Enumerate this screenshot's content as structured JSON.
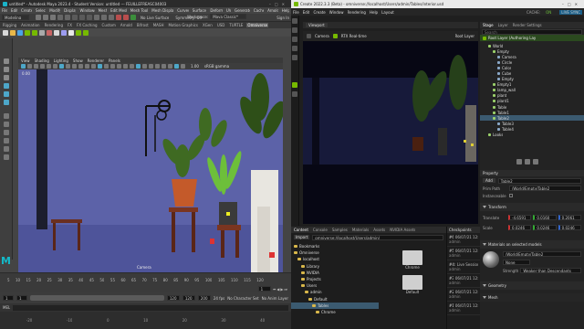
{
  "maya": {
    "title": "untitled* - Autodesk Maya 2023.4 - Student Version: untitled --- FEUILLEFREASC04003",
    "menu": [
      "File",
      "Edit",
      "Create",
      "Select",
      "Modify",
      "Display",
      "Windows",
      "Mesh",
      "Edit Mesh",
      "Mesh Tools",
      "Mesh Display",
      "Curves",
      "Surfaces",
      "Deform",
      "UV",
      "Generate",
      "Cache",
      "Arnold",
      "Help"
    ],
    "workspace_label": "Workspace:",
    "workspace_value": "Maya Classic*",
    "mode": "Modeling",
    "live_surface": "No Live Surface",
    "symmetry": "Symmetry: Off",
    "sign_in": "Sign In",
    "shelf_tabs": [
      "Rigging",
      "Animation",
      "Rendering",
      "FX",
      "FX Caching",
      "Custom",
      "Arnold",
      "Bifrost",
      "MASH",
      "Motion Graphics",
      "XGen",
      "USD",
      "TURTLE",
      "Omniverse"
    ],
    "active_shelf_tab": "Omniverse",
    "viewport_menu": [
      "View",
      "Shading",
      "Lighting",
      "Show",
      "Renderer",
      "Panels"
    ],
    "viewport_zero": "0.00",
    "viewport_one": "1.00",
    "colorspace": "sRGB gamma",
    "camera_label": "Camera",
    "time_ticks": [
      "5",
      "10",
      "15",
      "20",
      "25",
      "30",
      "35",
      "40",
      "45",
      "50",
      "55",
      "60",
      "65",
      "70",
      "75",
      "80",
      "85",
      "90",
      "95",
      "100",
      "105",
      "110",
      "115",
      "120"
    ],
    "current_frame": "1",
    "range_start": "1",
    "range_start2": "1",
    "range_end": "120",
    "range_end2": "120",
    "range_max": "200",
    "fps": "24 fps",
    "character_set": "No Character Set",
    "anim_layer": "No Anim Layer",
    "cmd_label": "MEL",
    "help_ticks": [
      "-20",
      "-10",
      "0",
      "10",
      "20",
      "30",
      "40"
    ]
  },
  "create": {
    "title": "Create 2022.3.3 (Beta) - omniverse://localhost/Users/admin/Tables/interior.usd",
    "menu": [
      "File",
      "Edit",
      "Create",
      "Window",
      "Rendering",
      "Help",
      "Layout"
    ],
    "cache_label": "CACHE:",
    "cache_state": "ON",
    "live_sync": "LIVE SYNC",
    "viewport_tab": "Viewport",
    "camera_btn": "Camera",
    "rtx_btn": "RTX Real-time",
    "root_layer_btn": "Root Layer",
    "stage_tabs": [
      "Stage",
      "Layer",
      "Render Settings"
    ],
    "stage_search": "Search",
    "root_layer": "Root Layer (Authoring Lay",
    "tree": [
      {
        "label": "World",
        "depth": 1
      },
      {
        "label": "Empty",
        "depth": 2
      },
      {
        "label": "Camera",
        "depth": 3
      },
      {
        "label": "Circle",
        "depth": 3
      },
      {
        "label": "Color",
        "depth": 3
      },
      {
        "label": "Cube",
        "depth": 3
      },
      {
        "label": "Empty",
        "depth": 3
      },
      {
        "label": "Empty1",
        "depth": 2
      },
      {
        "label": "lamp_wall",
        "depth": 2
      },
      {
        "label": "plant",
        "depth": 2
      },
      {
        "label": "plant1",
        "depth": 2
      },
      {
        "label": "Table",
        "depth": 2
      },
      {
        "label": "Table1",
        "depth": 2
      },
      {
        "label": "Table2",
        "depth": 2
      },
      {
        "label": "Table3",
        "depth": 3
      },
      {
        "label": "Table4",
        "depth": 3
      },
      {
        "label": "Looks",
        "depth": 1
      }
    ],
    "selected_index": 13,
    "property_tab": "Property",
    "add_btn": "Add",
    "prim_name": "Table2",
    "prim_path_label": "Prim Path",
    "prim_path": "/World/Empty/Table2",
    "instanceable_label": "Instanceable",
    "transform_label": "Transform",
    "translate_label": "Translate",
    "translate": [
      "-4.6591",
      "0.0160",
      "0.2061"
    ],
    "scale_label": "Scale",
    "scale": [
      "0.0246",
      "0.0246",
      "0.0246"
    ],
    "materials_label": "Materials on selected models",
    "material_path": "/World/Empty/Table2",
    "material_binding": "None",
    "strength_label": "Strength",
    "strength_value": "Weaker than Descendants",
    "geometry_label": "Geometry",
    "mesh_label": "Mesh",
    "content_tabs": [
      "Content",
      "Console",
      "Samples",
      "Materials",
      "Assets",
      "NVIDIA Assets"
    ],
    "import_btn": "Import",
    "content_path": "omniverse://localhost/Users/admin/",
    "folders": [
      "Bookmarks",
      "Omniverse",
      "localhost",
      "Library",
      "NVIDIA",
      "Projects",
      "Users",
      "admin",
      "Default",
      "Tables",
      "Chrome"
    ],
    "thumb_labels": [
      "Chrome",
      "Default"
    ],
    "checkpoints_title": "Checkpoints",
    "checkpoints": [
      {
        "id": "#6:",
        "date": "06/07/21 12:58 PM",
        "user": "admin"
      },
      {
        "id": "#5:",
        "date": "06/07/21 12:58 PM",
        "user": "admin"
      },
      {
        "id": "#4:",
        "date": "Live Session",
        "user": "admin"
      },
      {
        "id": "#3:",
        "date": "06/07/21 12:58 PM",
        "user": "admin"
      },
      {
        "id": "#2:",
        "date": "06/07/21 12:58 PM",
        "user": "admin"
      },
      {
        "id": "#1:",
        "date": "06/07/21 12:58 PM",
        "user": "admin"
      }
    ]
  },
  "colors": {
    "maya_viewport": "#5c62a8",
    "create_viewport": "#070714",
    "selection": "#3b5a70",
    "accent_green": "#6dbf3a"
  }
}
